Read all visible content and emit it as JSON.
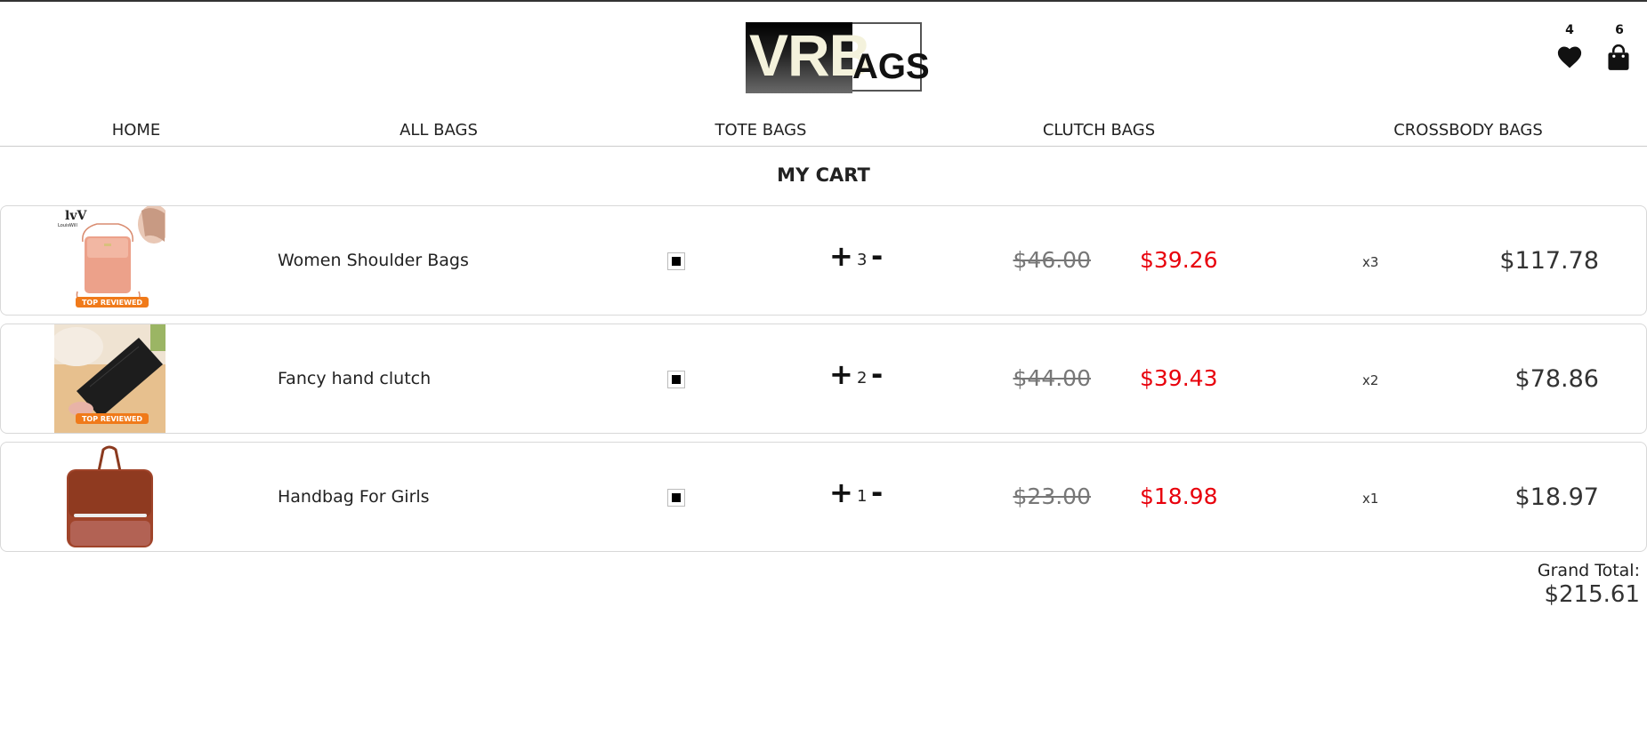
{
  "brand": {
    "logo_left": "VRB",
    "logo_right": "AGS"
  },
  "header": {
    "wishlist_count": "4",
    "cart_count": "6",
    "wishlist_icon": "heart-icon",
    "cart_icon": "shopping-bag-icon"
  },
  "nav": [
    {
      "label": "HOME"
    },
    {
      "label": "ALL BAGS"
    },
    {
      "label": "TOTE BAGS"
    },
    {
      "label": "CLUTCH BAGS"
    },
    {
      "label": "CROSSBODY BAGS"
    }
  ],
  "page_title": "MY CART",
  "cart": {
    "items": [
      {
        "name": "Women Shoulder Bags",
        "quantity": "3",
        "old_price": "$46.00",
        "price": "$39.26",
        "multiplier": "x3",
        "total": "$117.78",
        "selected": true,
        "badge": "TOP REVIEWED",
        "brand_mark": "LouisWill"
      },
      {
        "name": "Fancy hand clutch",
        "quantity": "2",
        "old_price": "$44.00",
        "price": "$39.43",
        "multiplier": "x2",
        "total": "$78.86",
        "selected": true,
        "badge": "TOP REVIEWED"
      },
      {
        "name": "Handbag For Girls",
        "quantity": "1",
        "old_price": "$23.00",
        "price": "$18.98",
        "multiplier": "x1",
        "total": "$18.97",
        "selected": true
      }
    ],
    "plus_symbol": "+",
    "minus_symbol": "-",
    "grand_total_label": "Grand Total:",
    "grand_total": "$215.61"
  },
  "colors": {
    "sale_price": "#e8000c",
    "accent_dark": "#111111"
  }
}
